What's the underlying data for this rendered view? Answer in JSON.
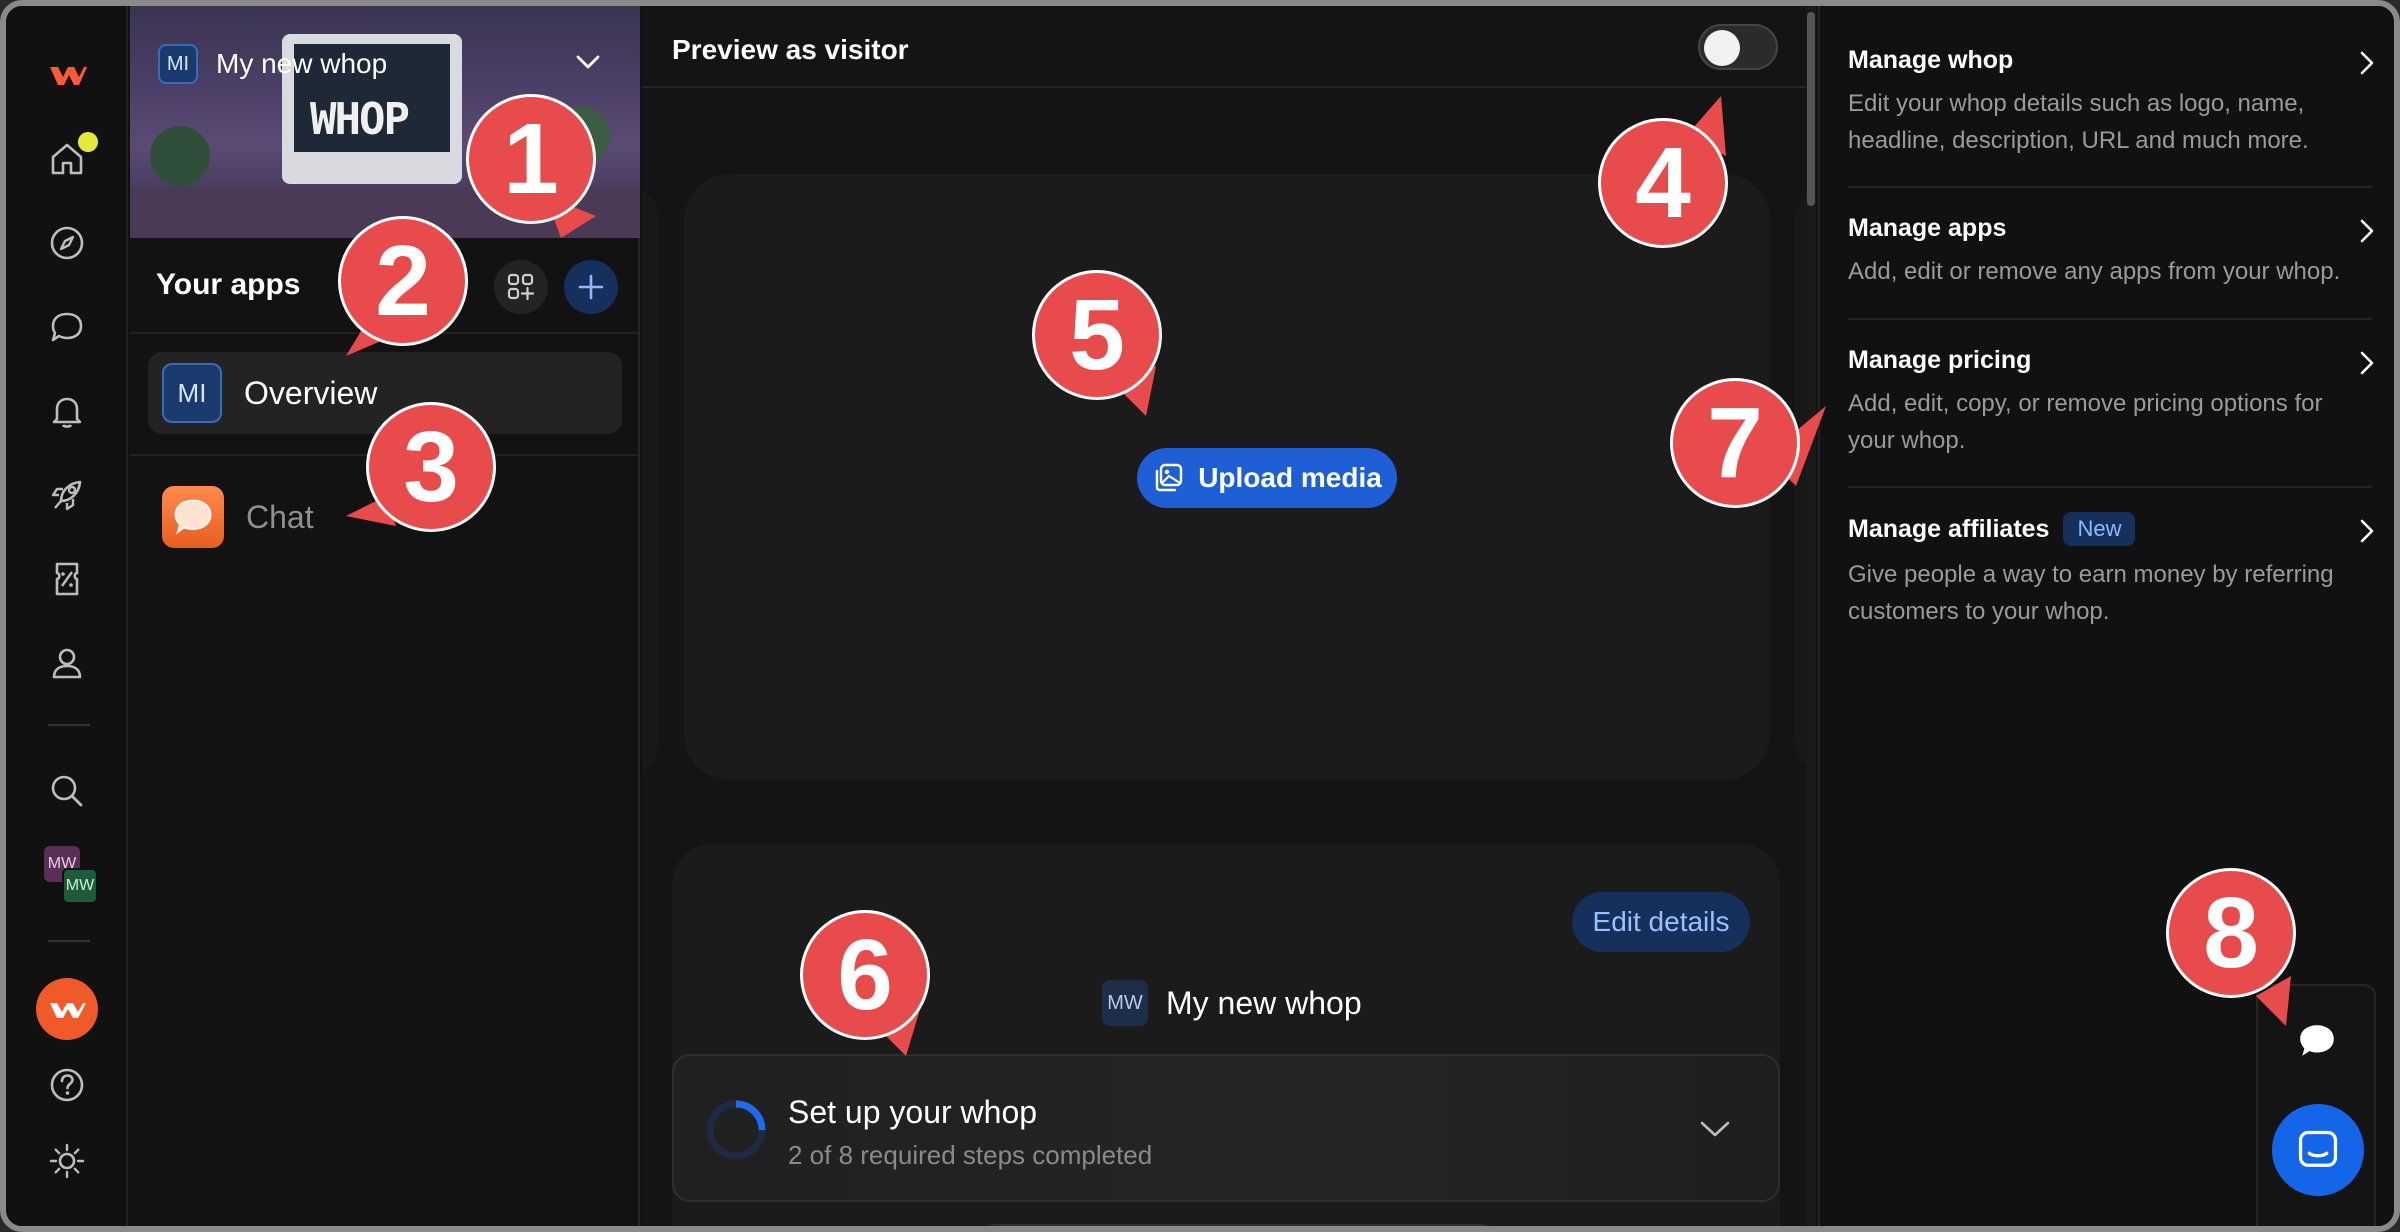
{
  "rail": {
    "icons": [
      "whop-logo-icon",
      "home-icon",
      "compass-icon",
      "chat-bubble-icon",
      "bell-icon",
      "rocket-icon",
      "discount-ticket-icon",
      "user-icon",
      "search-icon",
      "avatar-mw",
      "whop-orange-avatar",
      "help-icon",
      "theme-toggle-icon"
    ],
    "mw_top": "MW",
    "mw_bottom": "MW",
    "notification_color": "#e5e93a"
  },
  "apps_panel": {
    "whop_badge": "MI",
    "whop_name": "My new whop",
    "banner_text": "WHOP",
    "header": "Your apps",
    "items": [
      {
        "badge": "MI",
        "label": "Overview"
      },
      {
        "label": "Chat"
      }
    ]
  },
  "main": {
    "preview_label": "Preview as visitor",
    "preview_toggle_on": false,
    "upload_label": "Upload media",
    "edit_details_label": "Edit details",
    "whop_badge": "MW",
    "whop_name": "My new whop",
    "setup": {
      "title": "Set up your whop",
      "subtitle": "2 of 8 required steps completed",
      "completed": 2,
      "total": 8
    }
  },
  "right_panel": {
    "items": [
      {
        "title": "Manage whop",
        "desc": "Edit your whop details such as logo, name, headline, description, URL and much more."
      },
      {
        "title": "Manage apps",
        "desc": "Add, edit or remove any apps from your whop."
      },
      {
        "title": "Manage pricing",
        "desc": "Add, edit, copy, or remove pricing options for your whop."
      },
      {
        "title": "Manage affiliates",
        "badge": "New",
        "desc": "Give people a way to earn money by referring customers to your whop."
      }
    ]
  },
  "callouts": [
    "1",
    "2",
    "3",
    "4",
    "5",
    "6",
    "7",
    "8"
  ],
  "colors": {
    "accent": "#1e5fd6",
    "callout": "#e84b4b",
    "background": "#111111"
  }
}
